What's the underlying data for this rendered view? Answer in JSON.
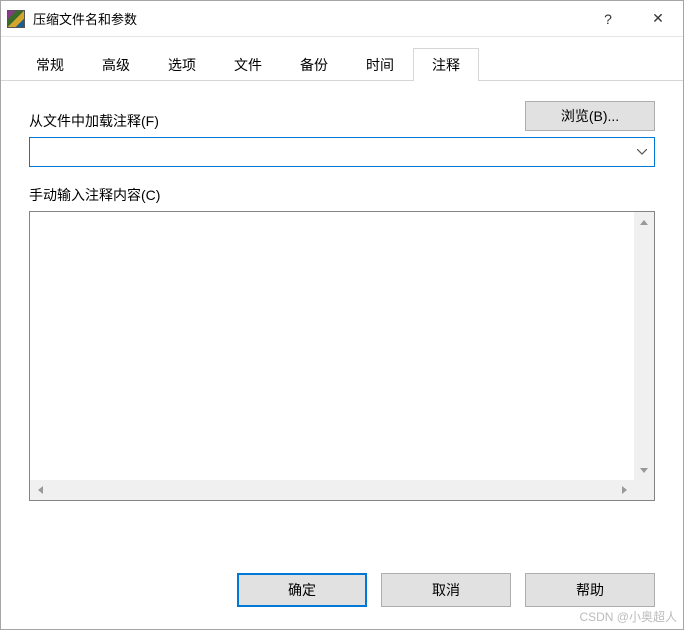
{
  "window": {
    "title": "压缩文件名和参数"
  },
  "titlebar_buttons": {
    "help": "?",
    "close": "✕"
  },
  "tabs": {
    "items": [
      "常规",
      "高级",
      "选项",
      "文件",
      "备份",
      "时间",
      "注释"
    ],
    "active_index": 6
  },
  "comment_tab": {
    "load_from_file_label": "从文件中加载注释(F)",
    "browse_button": "浏览(B)...",
    "combo_value": "",
    "manual_input_label": "手动输入注释内容(C)",
    "textarea_value": ""
  },
  "buttons": {
    "ok": "确定",
    "cancel": "取消",
    "help": "帮助"
  },
  "watermark": "CSDN @小奥超人"
}
